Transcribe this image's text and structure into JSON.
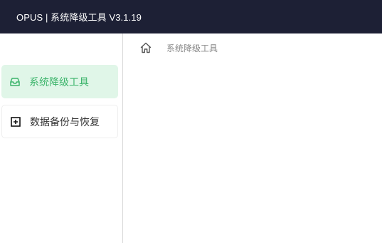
{
  "window": {
    "title": "OPUS | 系统降级工具  V3.1.19"
  },
  "sidebar": {
    "items": [
      {
        "label": "系统降级工具",
        "icon": "inbox-icon",
        "active": true
      },
      {
        "label": "数据备份与恢复",
        "icon": "plus-square-icon",
        "active": false
      }
    ]
  },
  "breadcrumb": {
    "home_icon": "home-icon",
    "current": "系统降级工具"
  },
  "colors": {
    "titlebar": "#1d2035",
    "accent": "#3bb46a",
    "active_bg": "#e0f6e8"
  }
}
